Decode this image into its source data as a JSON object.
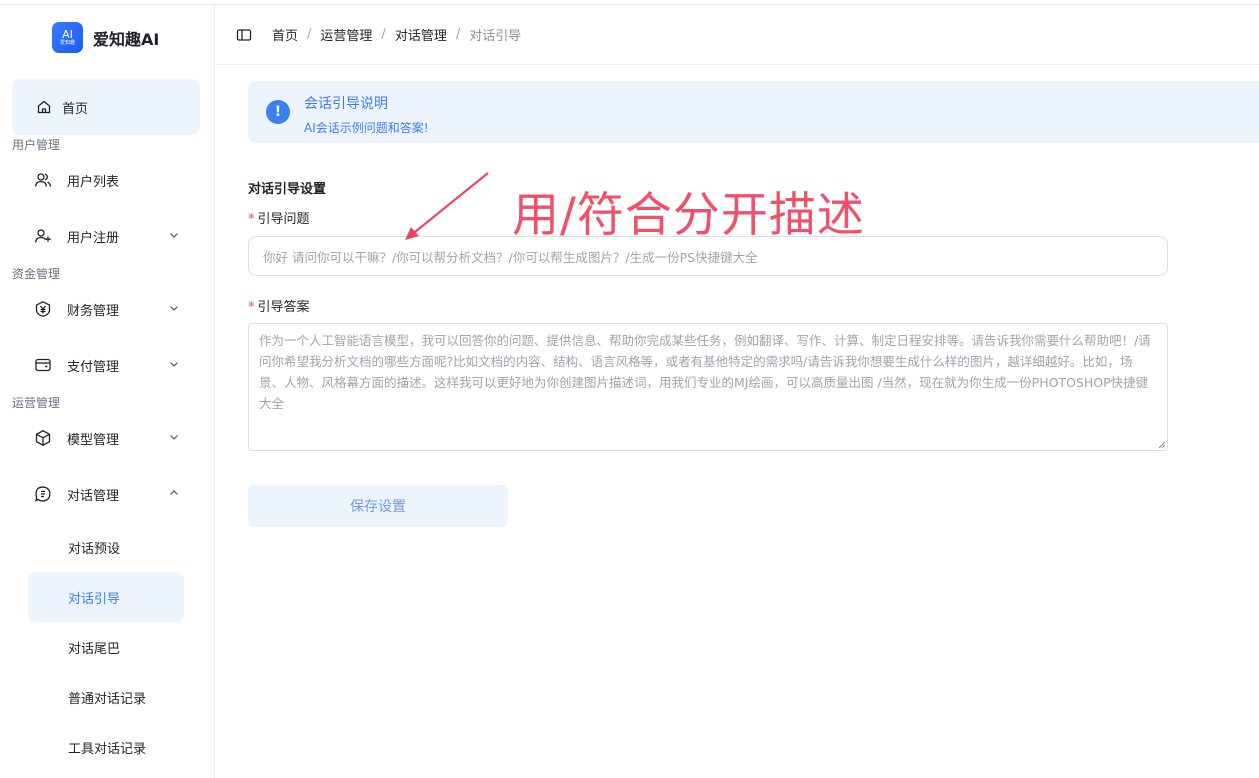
{
  "app": {
    "badge_top": "AI",
    "badge_bottom": "爱知趣",
    "name": "爱知趣AI"
  },
  "sidebar": {
    "home": "首页",
    "groups": [
      "用户管理",
      "资金管理",
      "运营管理"
    ],
    "items": [
      {
        "label": "用户列表",
        "icon": "users-icon"
      },
      {
        "label": "用户注册",
        "icon": "user-add-icon"
      },
      {
        "label": "财务管理",
        "icon": "yuan-icon"
      },
      {
        "label": "支付管理",
        "icon": "payment-icon"
      },
      {
        "label": "模型管理",
        "icon": "cube-icon"
      },
      {
        "label": "对话管理",
        "icon": "chat-icon"
      }
    ],
    "sub_items": [
      "对话预设",
      "对话引导",
      "对话尾巴",
      "普通对话记录",
      "工具对话记录"
    ]
  },
  "breadcrumb": [
    "首页",
    "运营管理",
    "对话管理",
    "对话引导"
  ],
  "alert": {
    "title": "会话引导说明",
    "desc": "AI会话示例问题和答案!"
  },
  "form": {
    "section_title": "对话引导设置",
    "required_mark": "*",
    "question_label": "引导问题",
    "question_value": "你好  请问你可以干嘛？/你可以帮分析文档？/你可以帮生成图片？/生成一份PS快捷键大全",
    "answer_label": "引导答案",
    "answer_value": "作为一个人工智能语言模型，我可以回答你的问题、提供信息、帮助你完成某些任务，例如翻译、写作、计算、制定日程安排等。请告诉我你需要什么帮助吧！/请问你希望我分析文档的哪些方面呢?比如文档的内容、结构、语言风格等，或者有基他特定的需求吗/请告诉我你想要生成什么样的图片，越详细越好。比如，场景、人物、风格幕方面的描述。这样我可以更好地为你创建图片描述词，用我们专业的MJ绘画，可以高质量出图 /当然，现在就为你生成一份PHOTOSHOP快捷键大全",
    "save_label": "保存设置"
  },
  "annotation": {
    "text": "用/符合分开描述",
    "color": "#f0506a"
  },
  "colors": {
    "accent": "#3c7ff0",
    "active_bg": "#eef4fd"
  }
}
